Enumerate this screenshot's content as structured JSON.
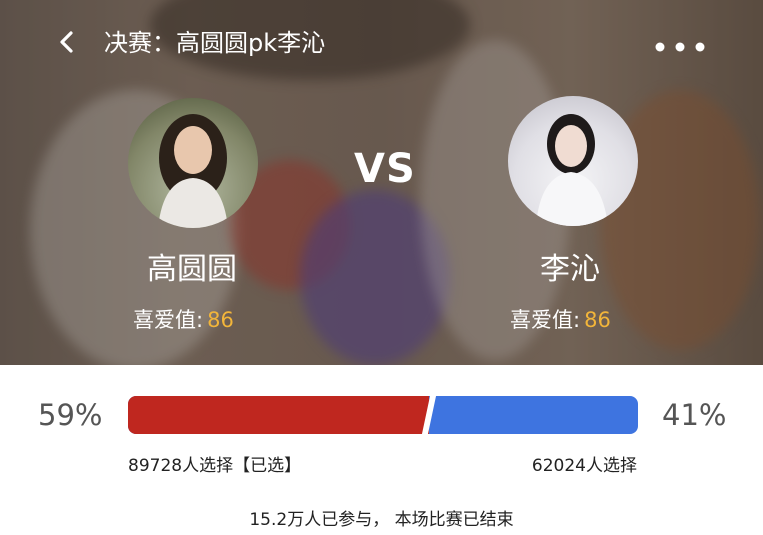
{
  "header": {
    "title": "决赛：高圆圆pk李沁"
  },
  "match": {
    "vs_label": "VS",
    "left": {
      "name": "高圆圆",
      "favor_label": "喜爱值:",
      "favor_value": "86",
      "percent": "59%",
      "votes_text": "89728人选择【已选】"
    },
    "right": {
      "name": "李沁",
      "favor_label": "喜爱值:",
      "favor_value": "86",
      "percent": "41%",
      "votes_text": "62024人选择"
    },
    "left_share": 0.59
  },
  "footer": {
    "summary": "15.2万人已参与，  本场比赛已结束"
  },
  "colors": {
    "left_bar": "#bf271f",
    "right_bar": "#3e74e0",
    "favor_value": "#f2b53a"
  },
  "icons": {
    "back": "back-chevron-icon",
    "more": "more-dots-icon"
  }
}
